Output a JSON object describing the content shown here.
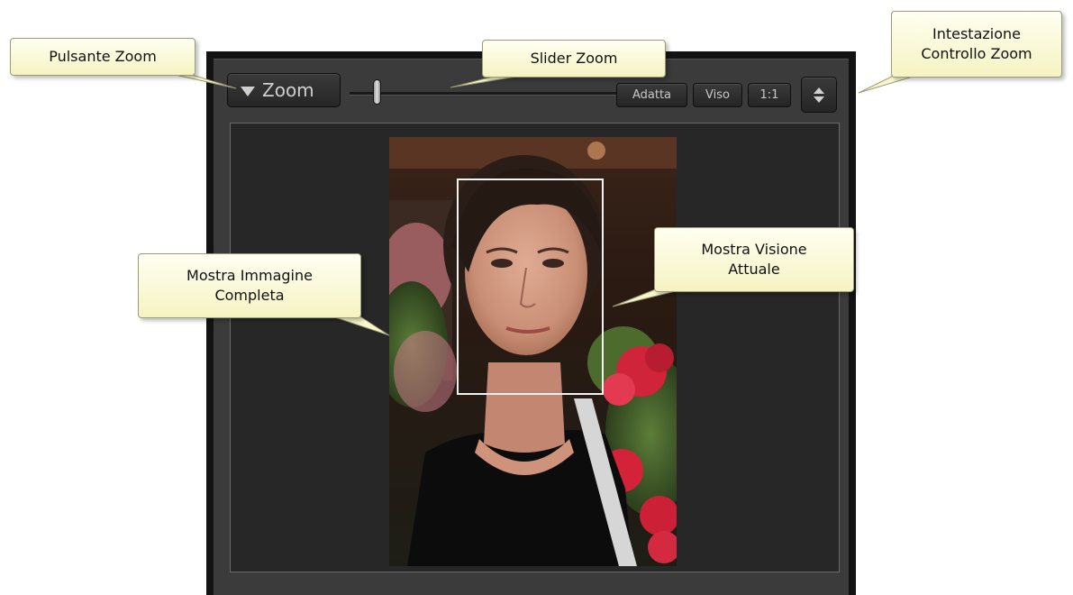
{
  "zoom_panel": {
    "zoom_button_label": "Zoom",
    "buttons": {
      "fit_label": "Adatta",
      "face_label": "Viso",
      "one_to_one_label": "1:1"
    },
    "slider": {
      "level": 0.05
    }
  },
  "callouts": {
    "zoom_button": "Pulsante Zoom",
    "zoom_slider": "Slider Zoom",
    "zoom_header_line1": "Intestazione",
    "zoom_header_line2": "Controllo Zoom",
    "full_image_line1": "Mostra Immagine",
    "full_image_line2": "Completa",
    "current_view_line1": "Mostra Visione",
    "current_view_line2": "Attuale"
  },
  "icons": {
    "zoom_toggle": "triangle-down-icon",
    "panel_toggle": "up-down-arrows-icon"
  },
  "colors": {
    "panel_bg": "#3b3b3b",
    "viewer_bg": "#272727",
    "callout_bg": "#f8f6cc"
  }
}
